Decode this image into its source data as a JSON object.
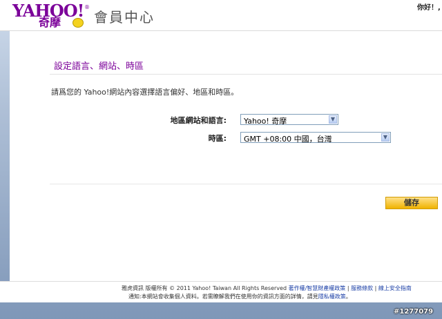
{
  "header": {
    "logo_text": "YAHOO!",
    "logo_sub": "奇摩",
    "logo_reg": "®",
    "site_title": "會員中心",
    "greeting": "你好！,"
  },
  "main": {
    "section_title": "設定語言、網站、時區",
    "intro": "請爲您的 Yahoo!網站內容選擇語言偏好、地區和時區。",
    "region_label": "地區網站和語言:",
    "region_value": "Yahoo! 奇摩",
    "timezone_label": "時區:",
    "timezone_value": "GMT +08:00 中國，台灣",
    "save_label": "儲存"
  },
  "footer": {
    "copyright": "雅虎資訊 版權所有 © 2011 Yahoo! Taiwan All Rights Reserved",
    "link_ip": "著作權/智慧財產權政策",
    "sep": " | ",
    "link_terms": "服務條款",
    "link_safety": "線上安全指南",
    "notice_text": "通知:本網站會收集個人資料。若需瞭解我們在使用你的資訊方面的詳情，請見",
    "link_privacy": "隱私權政策",
    "notice_end": "。"
  },
  "watermark": "#1277079"
}
